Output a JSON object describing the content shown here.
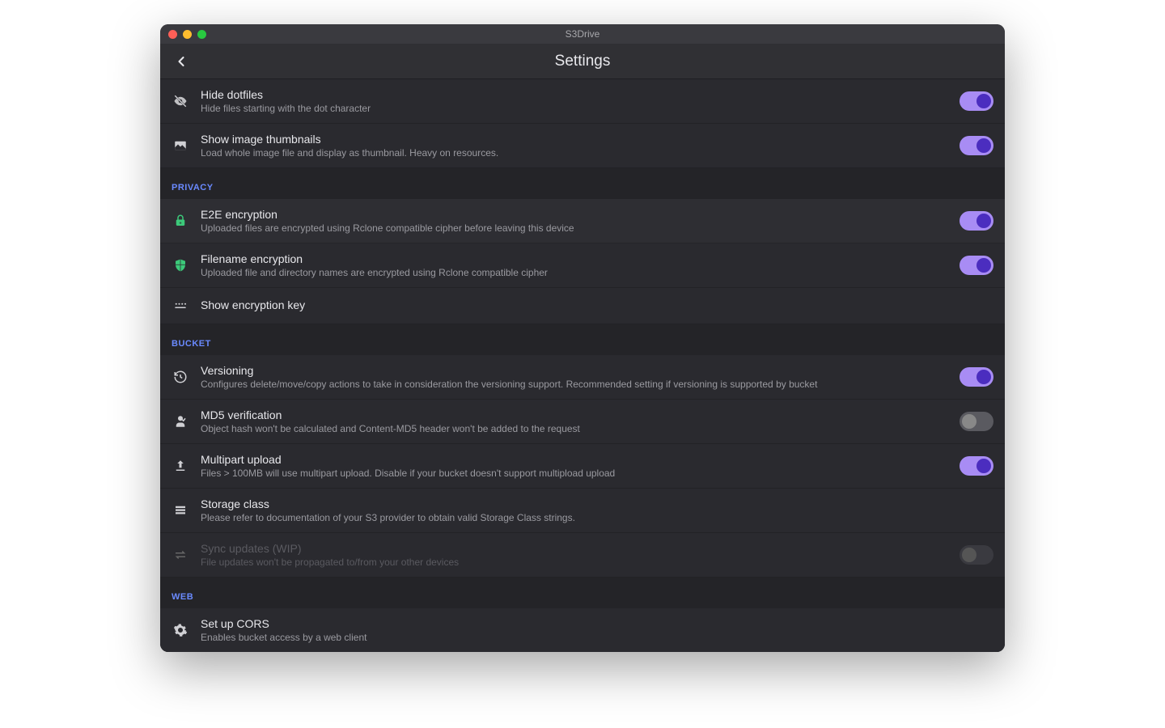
{
  "window": {
    "title": "S3Drive"
  },
  "header": {
    "title": "Settings"
  },
  "sections": {
    "top": {
      "hide_dotfiles": {
        "title": "Hide dotfiles",
        "desc": "Hide files starting with the dot character",
        "on": true
      },
      "show_thumbnails": {
        "title": "Show image thumbnails",
        "desc": "Load whole image file and display as thumbnail. Heavy on resources.",
        "on": true
      }
    },
    "privacy": {
      "label": "PRIVACY",
      "e2e": {
        "title": "E2E encryption",
        "desc": "Uploaded files are encrypted using Rclone compatible cipher before leaving this device",
        "on": true
      },
      "filename": {
        "title": "Filename encryption",
        "desc": "Uploaded file and directory names are encrypted using Rclone compatible cipher",
        "on": true
      },
      "show_key": {
        "title": "Show encryption key"
      }
    },
    "bucket": {
      "label": "BUCKET",
      "versioning": {
        "title": "Versioning",
        "desc": "Configures delete/move/copy actions to take in consideration the versioning support. Recommended setting if versioning is supported by bucket",
        "on": true
      },
      "md5": {
        "title": "MD5 verification",
        "desc": "Object hash won't be calculated and Content-MD5 header won't be added to the request",
        "on": false
      },
      "multipart": {
        "title": "Multipart upload",
        "desc": "Files > 100MB will use multipart upload. Disable if your bucket doesn't support multipload upload",
        "on": true
      },
      "storage_class": {
        "title": "Storage class",
        "desc": "Please refer to documentation of your S3 provider to obtain valid Storage Class strings."
      },
      "sync": {
        "title": "Sync updates (WIP)",
        "desc": "File updates won't be propagated to/from your other devices",
        "on": false
      }
    },
    "web": {
      "label": "WEB",
      "cors": {
        "title": "Set up CORS",
        "desc": "Enables bucket access by a web client"
      }
    }
  }
}
